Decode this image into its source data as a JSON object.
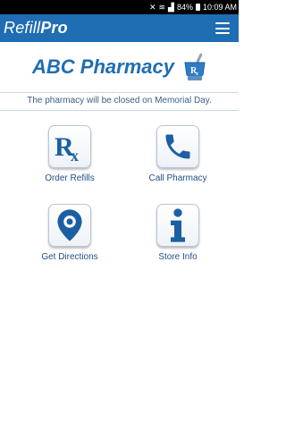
{
  "status_bar": {
    "battery_percent": "84%",
    "time": "10:09 AM"
  },
  "app_bar": {
    "title_regular": "Refill",
    "title_bold": "Pro",
    "menu_icon": "hamburger-icon"
  },
  "header": {
    "pharmacy_name": "ABC Pharmacy",
    "logo_icon": "mortar-pestle-rx-icon"
  },
  "notice": {
    "text": "The pharmacy will be closed on Memorial Day."
  },
  "tiles": [
    {
      "label": "Order Refills",
      "icon": "rx-icon"
    },
    {
      "label": "Call Pharmacy",
      "icon": "phone-icon"
    },
    {
      "label": "Get Directions",
      "icon": "map-pin-icon"
    },
    {
      "label": "Store Info",
      "icon": "info-icon"
    }
  ],
  "colors": {
    "brand": "#1f6db2",
    "icon_blue": "#1a5fa3"
  }
}
